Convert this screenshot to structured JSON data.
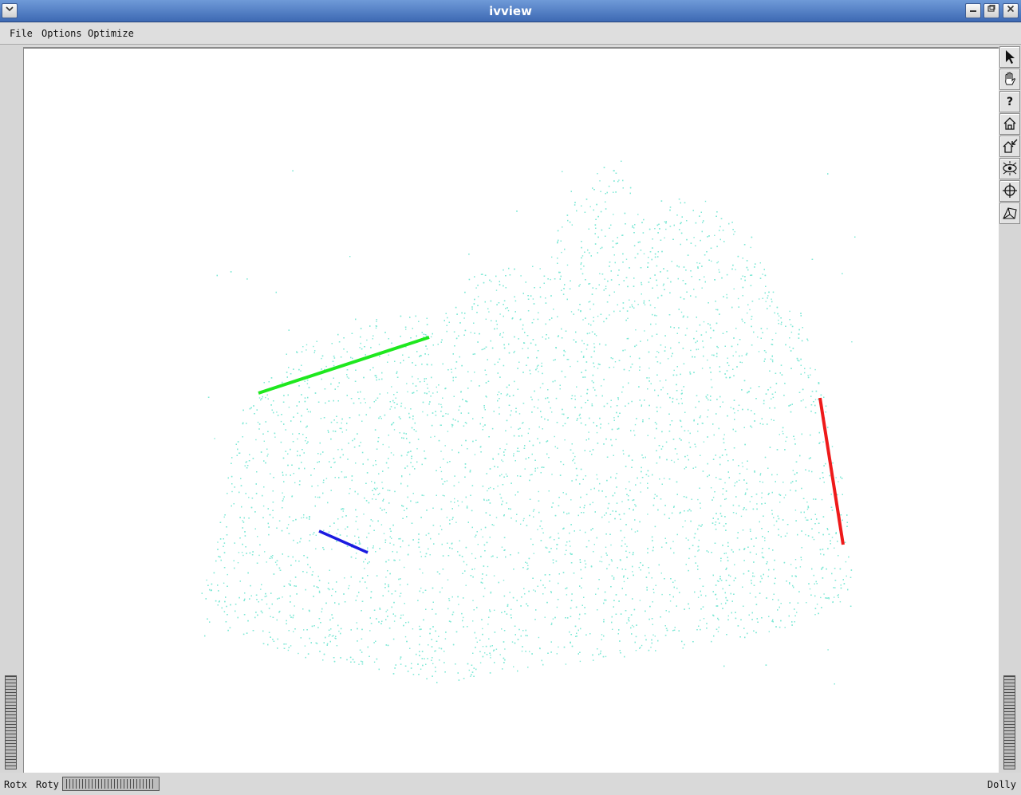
{
  "window": {
    "title": "ivview",
    "menu_icon": "chevron-down-icon",
    "minimize_icon": "minimize-icon",
    "maximize_icon": "maximize-icon",
    "close_icon": "close-icon"
  },
  "menubar": {
    "items": [
      "File",
      "Options",
      "Optimize"
    ]
  },
  "toolbar": {
    "tools": [
      "select-arrow-icon",
      "hand-icon",
      "question-icon",
      "home-icon",
      "set-home-icon",
      "view-all-eye-icon",
      "seek-crosshair-icon",
      "perspective-cube-icon"
    ]
  },
  "bottombar": {
    "rotx_label": "Rotx",
    "roty_label": "Roty",
    "dolly_label": "Dolly"
  },
  "scene": {
    "point_color": "#7fe8d6",
    "lines": [
      {
        "name": "green-line",
        "color": "#1ee81e"
      },
      {
        "name": "red-line",
        "color": "#ee1a1a"
      },
      {
        "name": "blue-line",
        "color": "#1a1ae0"
      }
    ]
  }
}
